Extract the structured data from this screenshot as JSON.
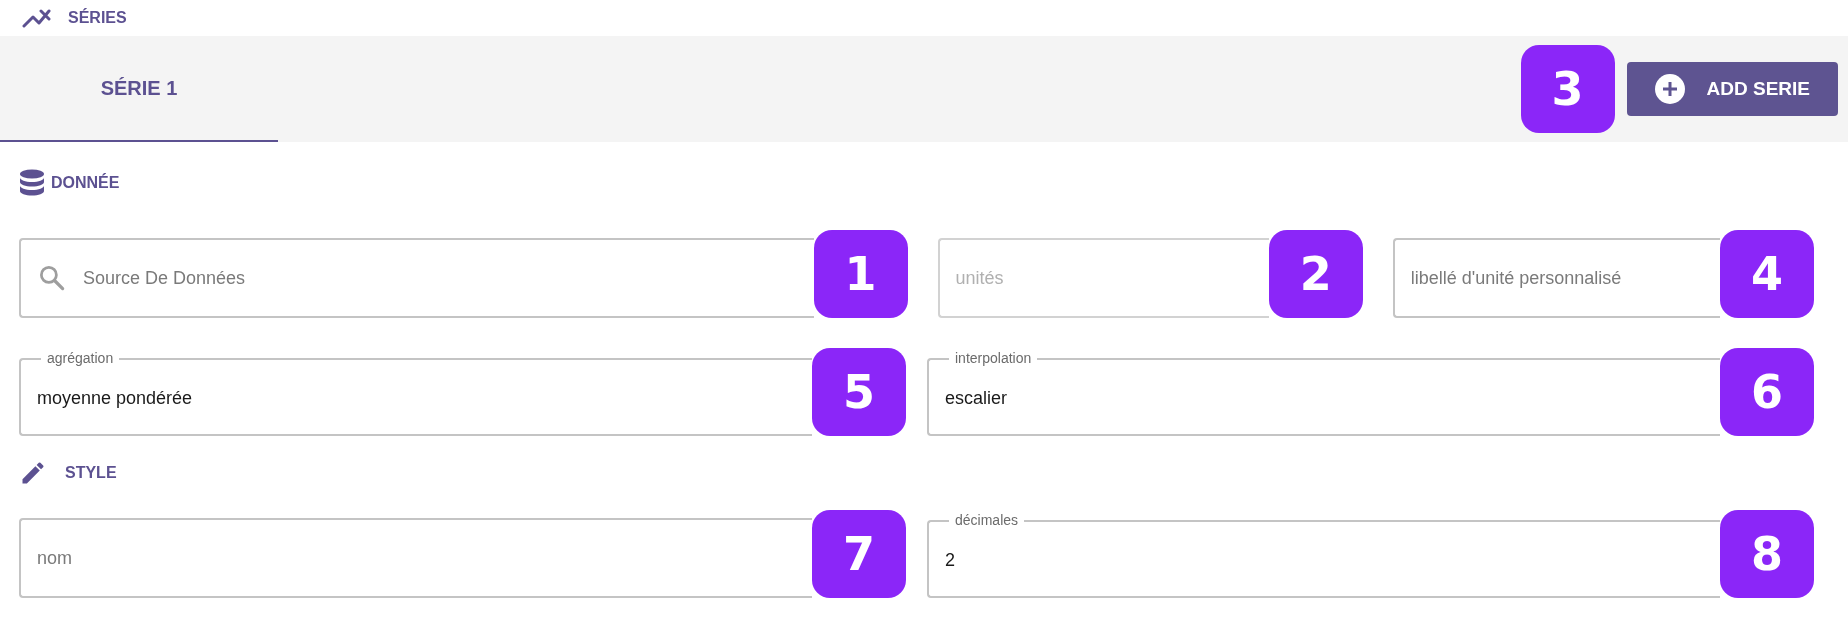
{
  "header": {
    "title": "SÉRIES"
  },
  "tabs": [
    {
      "label": "SÉRIE 1",
      "selected": true
    }
  ],
  "add_button": {
    "label": "ADD SERIE",
    "badge": "3"
  },
  "sections": [
    {
      "title": "DONNÉE",
      "kind": "database",
      "rows": [
        [
          {
            "kind": "search",
            "placeholder": "Source De Données",
            "disabled": false,
            "badge": "1"
          },
          {
            "kind": "text",
            "placeholder": "unités",
            "disabled": true,
            "badge": "2"
          },
          {
            "kind": "text",
            "placeholder": "libellé d'unité personnalisé",
            "disabled": false,
            "badge": "4"
          }
        ],
        [
          {
            "label": "agrégation",
            "value": "moyenne pondérée",
            "disabled": false,
            "badge": "5"
          },
          {
            "label": "interpolation",
            "value": "escalier",
            "disabled": false,
            "badge": "6"
          }
        ]
      ]
    },
    {
      "title": "STYLE",
      "kind": "pencil",
      "rows": [
        [
          {
            "placeholder": "nom",
            "disabled": false,
            "badge": "7"
          },
          {
            "label": "décimales",
            "value": "2",
            "disabled": false,
            "badge": "8"
          }
        ]
      ]
    }
  ]
}
